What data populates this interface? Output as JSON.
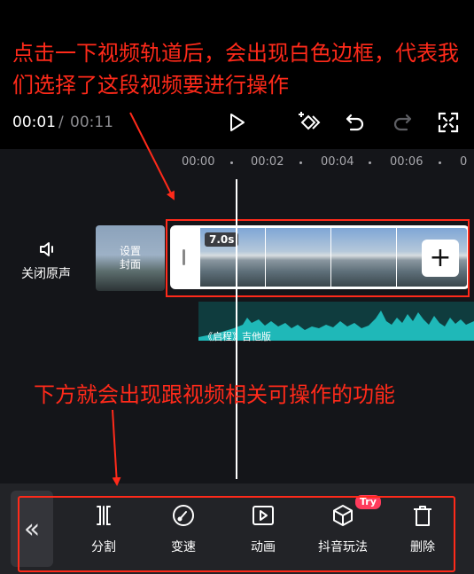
{
  "annotations": {
    "top": "点击一下视频轨道后，会出现白色边框，代表我们选择了这段视频要进行操作",
    "middle": "下方就会出现跟视频相关可操作的功能"
  },
  "player": {
    "current_time": "00:01",
    "separator": "/",
    "total_time": "00:11"
  },
  "timeline": {
    "ticks": [
      "00:00",
      "00:02",
      "00:04",
      "00:06",
      "0"
    ],
    "mute_label": "关闭原声",
    "cover_label_line1": "设置",
    "cover_label_line2": "封面",
    "clip_duration": "7.0s",
    "add_clip_label": "+",
    "audio_label": "《启程》吉他版"
  },
  "toolbar": {
    "collapse_label": "«",
    "try_badge": "Try",
    "items": [
      {
        "label": "分割",
        "icon": "split-icon"
      },
      {
        "label": "变速",
        "icon": "speed-icon"
      },
      {
        "label": "动画",
        "icon": "animation-icon"
      },
      {
        "label": "抖音玩法",
        "icon": "cube-icon"
      },
      {
        "label": "删除",
        "icon": "trash-icon"
      }
    ]
  },
  "colors": {
    "annotation_red": "#ff2a1a",
    "audio_wave": "#1fb8b8",
    "try_badge": "#ff3b5c"
  }
}
